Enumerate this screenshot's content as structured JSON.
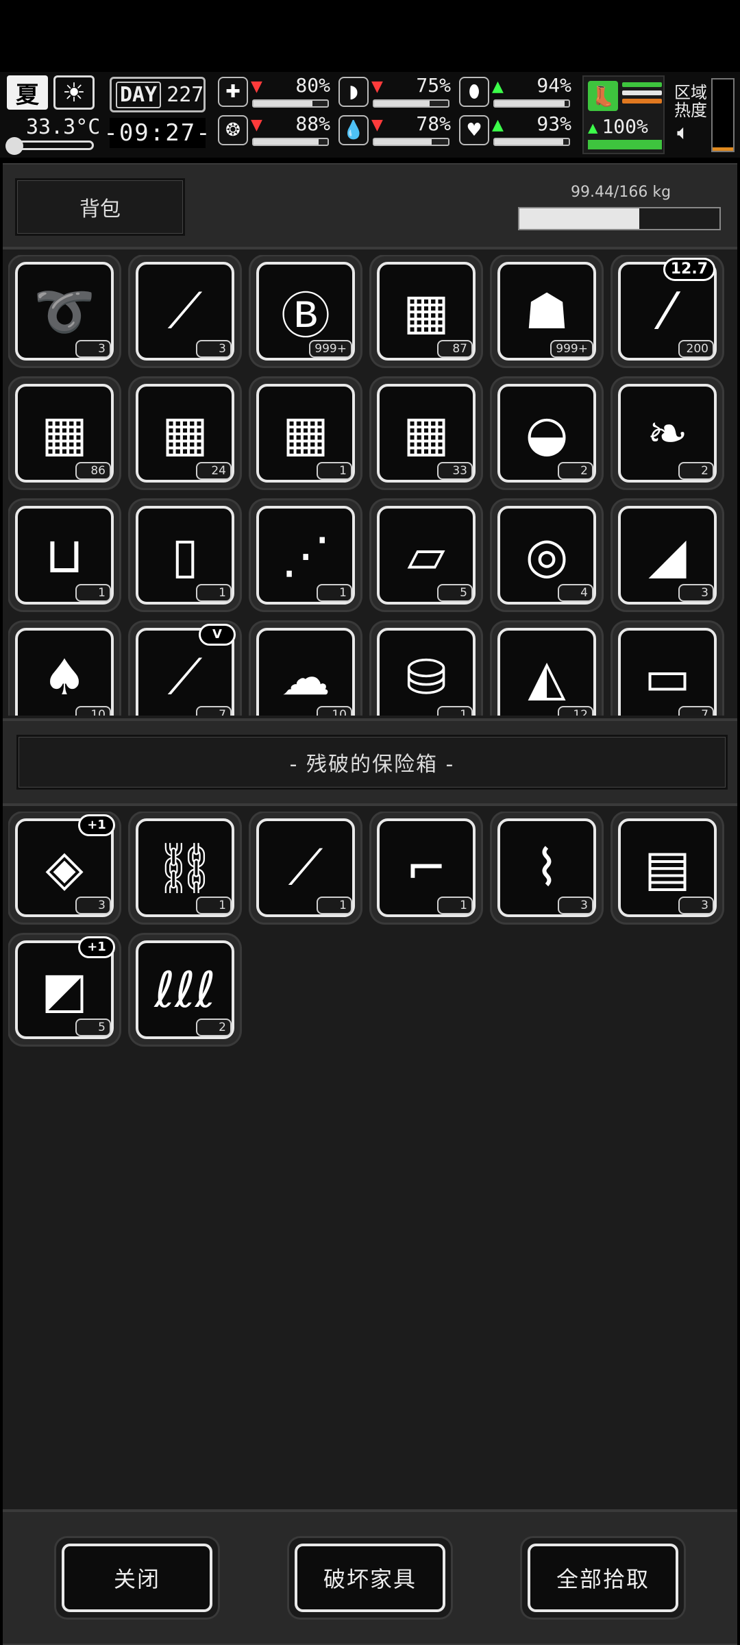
{
  "status": {
    "season": "夏",
    "temperature": "33.3°C",
    "day_label": "DAY",
    "day_number": "227",
    "time": "-09:27-",
    "stats": [
      {
        "icon": "medkit-icon",
        "glyph": "✚",
        "trend": "down",
        "value": "80%",
        "level": 0.8
      },
      {
        "icon": "stomach-icon",
        "glyph": "◗",
        "trend": "down",
        "value": "75%",
        "level": 0.75
      },
      {
        "icon": "pill-icon",
        "glyph": "⬮",
        "trend": "up",
        "value": "94%",
        "level": 0.94
      },
      {
        "icon": "brain-icon",
        "glyph": "❂",
        "trend": "down",
        "value": "88%",
        "level": 0.88
      },
      {
        "icon": "water-drop-icon",
        "glyph": "💧",
        "trend": "down",
        "value": "78%",
        "level": 0.78
      },
      {
        "icon": "heart-icon",
        "glyph": "♥",
        "trend": "up",
        "value": "93%",
        "level": 0.93
      }
    ],
    "stamina": {
      "value": "100%",
      "level": 1.0
    },
    "heat_label": "区域\n热度",
    "heat_level": 0.05
  },
  "backpack": {
    "title": "背包",
    "weight": "99.44/166 kg",
    "weight_fraction": 0.599,
    "items": [
      {
        "name": "rope-icon",
        "glyph": "➰",
        "count": "3"
      },
      {
        "name": "lockpick-icon",
        "glyph": "⟋",
        "count": "3"
      },
      {
        "name": "bitcoin-coin-icon",
        "glyph": "Ⓑ",
        "count": "999+"
      },
      {
        "name": "supply-crate-icon",
        "glyph": "▦",
        "count": "87"
      },
      {
        "name": "zombie-poster-icon",
        "glyph": "☗",
        "count": "999+"
      },
      {
        "name": "rifle-bullet-icon",
        "glyph": "⁄",
        "count": "200",
        "badge": "12.7"
      },
      {
        "name": "supply-crate-icon",
        "glyph": "▦",
        "count": "86"
      },
      {
        "name": "supply-crate-icon",
        "glyph": "▦",
        "count": "24"
      },
      {
        "name": "supply-crate-icon",
        "glyph": "▦",
        "count": "1"
      },
      {
        "name": "supply-crate-icon",
        "glyph": "▦",
        "count": "33"
      },
      {
        "name": "soup-bowl-icon",
        "glyph": "◒",
        "count": "2"
      },
      {
        "name": "cloth-icon",
        "glyph": "❧",
        "count": "2"
      },
      {
        "name": "beaker-icon",
        "glyph": "⊔",
        "count": "1"
      },
      {
        "name": "water-bottle-icon",
        "glyph": "▯",
        "count": "1"
      },
      {
        "name": "skewer-icon",
        "glyph": "⋰",
        "count": "1"
      },
      {
        "name": "bread-slices-icon",
        "glyph": "▱",
        "count": "5"
      },
      {
        "name": "fabric-rolls-icon",
        "glyph": "◎",
        "count": "4"
      },
      {
        "name": "folded-cloth-icon",
        "glyph": "◢",
        "count": "3"
      },
      {
        "name": "torn-shirt-icon",
        "glyph": "♠",
        "count": "10"
      },
      {
        "name": "vaccine-tube-icon",
        "glyph": "⟋",
        "count": "7",
        "badge": "V"
      },
      {
        "name": "cloth-pile-icon",
        "glyph": "☁",
        "count": "10"
      },
      {
        "name": "coin-stack-icon",
        "glyph": "⛁",
        "count": "1"
      },
      {
        "name": "burrito-icon",
        "glyph": "◭",
        "count": "12"
      },
      {
        "name": "paper-bag-icon",
        "glyph": "▭",
        "count": "7"
      }
    ]
  },
  "container": {
    "title": "- 残破的保险箱 -",
    "items": [
      {
        "name": "plastic-bag-icon",
        "glyph": "◈",
        "count": "3",
        "badge": "+1"
      },
      {
        "name": "chainsaw-chain-icon",
        "glyph": "⛓",
        "count": "1"
      },
      {
        "name": "knife-icon",
        "glyph": "⟋",
        "count": "1"
      },
      {
        "name": "nail-gun-icon",
        "glyph": "⌐",
        "count": "1"
      },
      {
        "name": "pipe-parts-icon",
        "glyph": "⌇",
        "count": "3"
      },
      {
        "name": "cash-bundle-icon",
        "glyph": "▤",
        "count": "3"
      },
      {
        "name": "plank-icon",
        "glyph": "◩",
        "count": "5",
        "badge": "+1"
      },
      {
        "name": "spring-icon",
        "glyph": "ℓℓℓ",
        "count": "2"
      }
    ]
  },
  "buttons": {
    "close": "关闭",
    "destroy": "破坏家具",
    "take_all": "全部拾取"
  }
}
